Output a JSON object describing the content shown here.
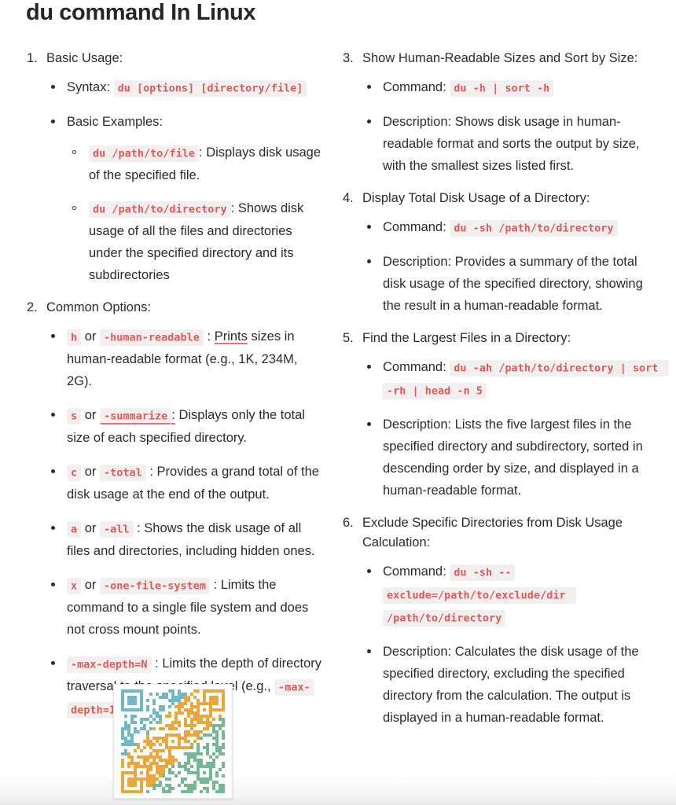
{
  "document": {
    "title": "du command In Linux",
    "background_color": "#ffffff",
    "code_text_color": "#e05a55",
    "code_bg_color": "#f1efef",
    "spellcheck_underline_color": "#e8707a"
  },
  "left_column": {
    "items": [
      {
        "number": "1.",
        "heading": "Basic Usage:",
        "bullets": [
          {
            "label": "Syntax:",
            "code": "du [options] [directory/file]"
          },
          {
            "label": "Basic Examples:",
            "subbullets": [
              {
                "code": "du /path/to/file",
                "text": ": Displays disk usage of the specified file."
              },
              {
                "code": "du /path/to/directory",
                "text": ": Shows disk usage of all the files and directories under the specified directory and its subdirectories"
              }
            ]
          }
        ]
      },
      {
        "number": "2.",
        "heading": "Common Options:",
        "options": [
          {
            "flag_short": "h",
            "or": "or",
            "flag_long": "-human-readable",
            "colon": ":",
            "misspelled": "Prints",
            "text_after": " sizes in human-readable format (e.g., 1K, 234M, 2G)."
          },
          {
            "flag_short": "s",
            "or": "or",
            "flag_long": "-summarize",
            "colon": ":",
            "text_after": " Displays only the total size of each specified directory."
          },
          {
            "flag_short": "c",
            "or": "or",
            "flag_long": "-total",
            "colon": ":",
            "text_after": " Provides a grand total of the disk usage at the end of the output."
          },
          {
            "flag_short": "a",
            "or": "or",
            "flag_long": "-all",
            "colon": ":",
            "text_after": " Shows the disk usage of all files and directories, including hidden ones."
          },
          {
            "flag_short": "x",
            "or": "or",
            "flag_long": "-one-file-system",
            "colon": ":",
            "text_after": " Limits the command to a single file system and does not cross mount points."
          },
          {
            "flag_long": "-max-depth=N",
            "colon": ":",
            "text_after": " Limits the depth of directory traversal to the specified level (e.g., ",
            "code_example": "-max-depth=1",
            "text_end": ")."
          }
        ]
      }
    ]
  },
  "right_column": {
    "items": [
      {
        "number": "3.",
        "heading": "Show Human-Readable Sizes and Sort by Size:",
        "command_label": "Command:",
        "command": "du -h | sort -h",
        "description_label": "Description:",
        "description": " Shows disk usage in human-readable format and sorts the output by size, with the smallest sizes listed first."
      },
      {
        "number": "4.",
        "heading": "Display Total Disk Usage of a Directory:",
        "command_label": "Command:",
        "command": "du -sh /path/to/directory",
        "description_label": "Description:",
        "description": " Provides a summary of the total disk usage of the specified directory, showing the result in a human-readable format."
      },
      {
        "number": "5.",
        "heading": "Find the Largest Files in a Directory:",
        "command_label": "Command:",
        "command": "du -ah /path/to/directory | sort -rh | head -n 5",
        "description_label": "Description:",
        "description": " Lists the five largest files in the specified directory and subdirectory, sorted in descending order by size, and displayed in a human-readable format."
      },
      {
        "number": "6.",
        "heading": "Exclude Specific Directories from Disk Usage Calculation:",
        "command_label": "Command:",
        "command": "du -sh --exclude=/path/to/exclude/dir /path/to/directory",
        "description_label": "Description:",
        "description": " Calculates the disk usage of the specified directory, excluding the specified directory from the calculation. The output is displayed in a human-readable format."
      }
    ]
  },
  "qr_code": {
    "name": "qr-code",
    "colors": {
      "teal": "#6bb7c4",
      "orange": "#e8a councils"
    }
  }
}
